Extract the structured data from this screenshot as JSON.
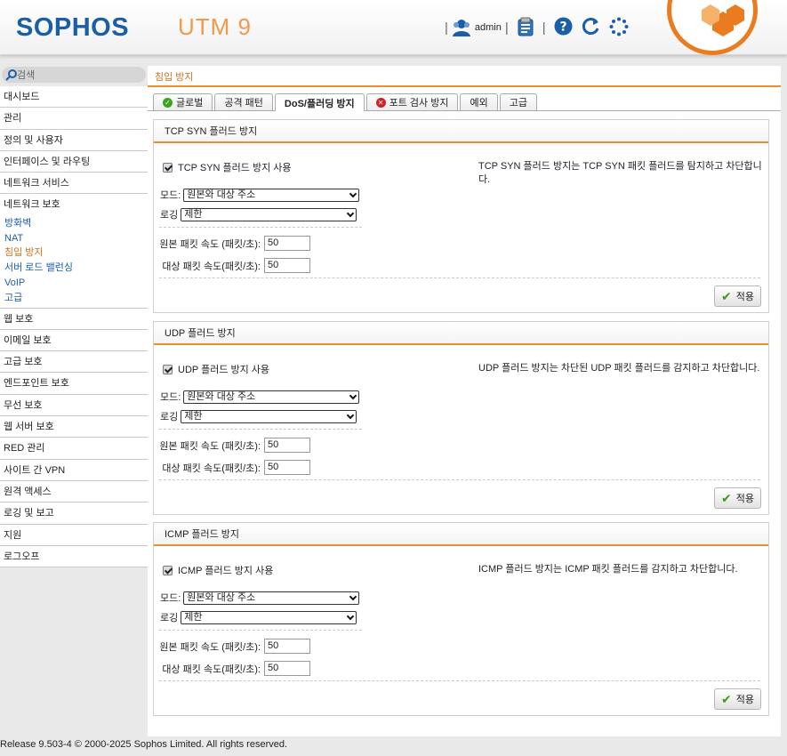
{
  "header": {
    "brand": "SOPHOS",
    "product": "UTM 9",
    "user": "admin"
  },
  "search": {
    "placeholder": "검색"
  },
  "sidebar": {
    "items_top": [
      "대시보드",
      "관리",
      "정의 및 사용자",
      "인터페이스 및 라우팅",
      "네트워크 서비스"
    ],
    "active_group": "네트워크 보호",
    "subitems": [
      "방화벽",
      "NAT",
      "침입 방지",
      "서버 로드 밸런싱",
      "VoIP",
      "고급"
    ],
    "current_subitem_index": 2,
    "items_bottom": [
      "웹 보호",
      "이메일 보호",
      "고급 보호",
      "엔드포인트 보호",
      "무선 보호",
      "웹 서버 보호",
      "RED 관리",
      "사이트 간 VPN",
      "원격 액세스",
      "로깅 및 보고",
      "지원",
      "로그오프"
    ]
  },
  "main": {
    "title": "침입 방지",
    "tabs": [
      {
        "label": "글로벌",
        "icon": "check-circle-icon",
        "icon_color": "#3aa31f"
      },
      {
        "label": "공격 패턴"
      },
      {
        "label": "DoS/플러딩 방지",
        "active": true
      },
      {
        "label": "포트 검사 방지",
        "icon": "error-circle-icon",
        "icon_color": "#d42020"
      },
      {
        "label": "예외"
      },
      {
        "label": "고급"
      }
    ],
    "sections": [
      {
        "title": "TCP SYN 플러드 방지",
        "enable_label": "TCP SYN 플러드 방지 사용",
        "enabled": true,
        "description": "TCP SYN 플러드 방지는 TCP SYN 패킷 플러드를 탐지하고 차단합니다.",
        "mode_label": "모드:",
        "mode_value": "원본와 대상 주소",
        "logging_label": "로깅",
        "logging_value": "제한",
        "src_rate_label": "원본 패킷 속도 (패킷/초):",
        "src_rate_value": "50",
        "dst_rate_label": "대상 패킷 속도(패킷/초):",
        "dst_rate_value": "50",
        "apply_label": "적용"
      },
      {
        "title": "UDP 플러드 방지",
        "enable_label": "UDP 플러드 방지 사용",
        "enabled": true,
        "description": "UDP 플러드 방지는 차단된 UDP 패킷 플러드를 감지하고 차단합니다.",
        "mode_label": "모드:",
        "mode_value": "원본와 대상 주소",
        "logging_label": "로깅",
        "logging_value": "제한",
        "src_rate_label": "원본 패킷 속도 (패킷/초):",
        "src_rate_value": "50",
        "dst_rate_label": "대상 패킷 속도(패킷/초):",
        "dst_rate_value": "50",
        "apply_label": "적용"
      },
      {
        "title": "ICMP 플러드 방지",
        "enable_label": "ICMP 플러드 방지 사용",
        "enabled": true,
        "description": "ICMP 플러드 방지는 ICMP 패킷 플러드를 감지하고 차단합니다.",
        "mode_label": "모드:",
        "mode_value": "원본와 대상 주소",
        "logging_label": "로깅",
        "logging_value": "제한",
        "src_rate_label": "원본 패킷 속도 (패킷/초):",
        "src_rate_value": "50",
        "dst_rate_label": "대상 패킷 속도(패킷/초):",
        "dst_rate_value": "50",
        "apply_label": "적용"
      }
    ]
  },
  "footer": {
    "text": "Release 9.503-4  © 2000-2025 Sophos Limited. All rights reserved."
  },
  "colors": {
    "brand_blue": "#1b5ea8",
    "accent_orange": "#ea8e2f",
    "link_blue": "#1b5ea8",
    "current_orange": "#d4711a"
  }
}
